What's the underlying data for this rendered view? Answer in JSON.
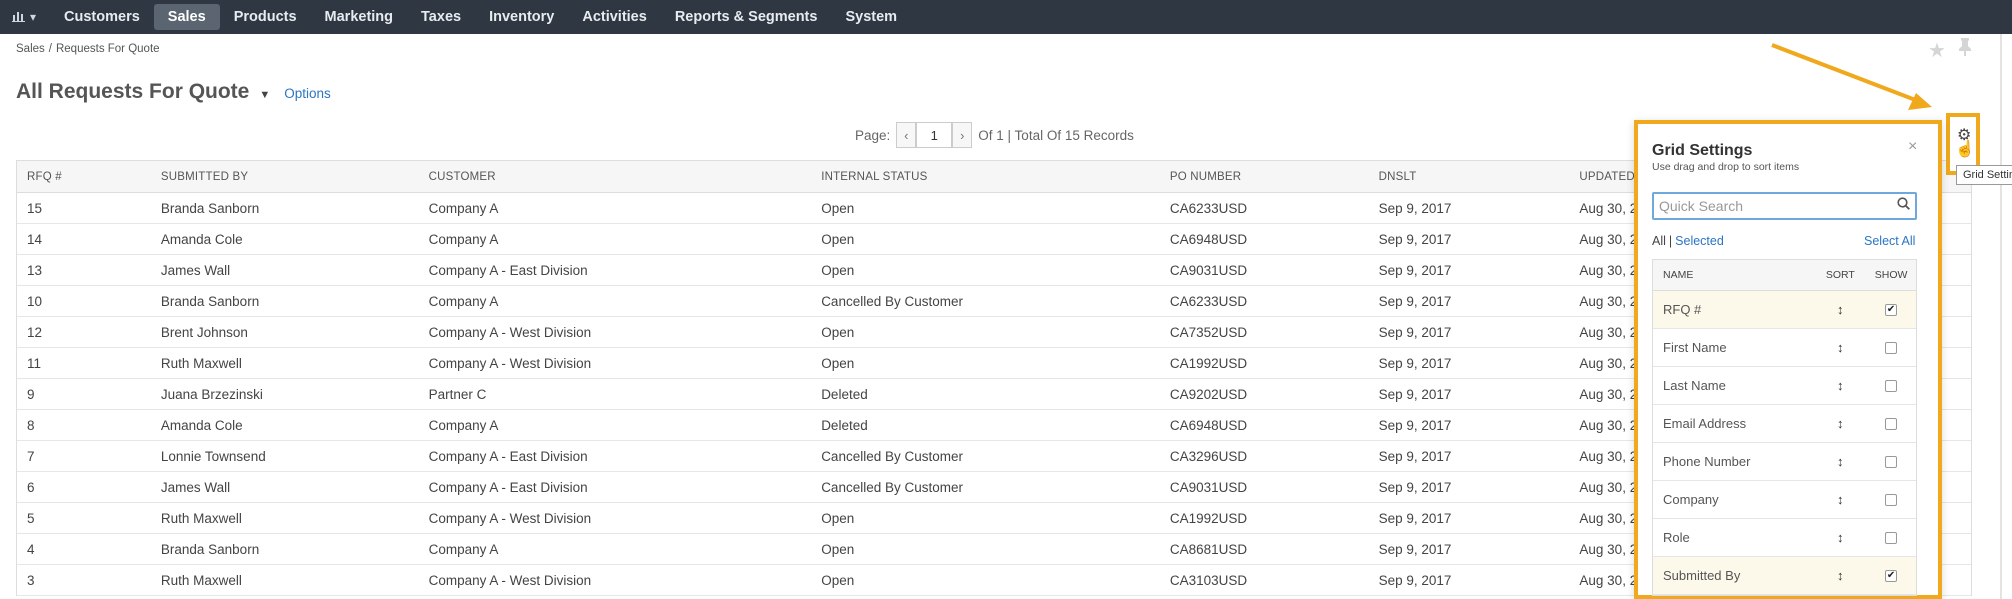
{
  "nav": {
    "items": [
      {
        "label": "Customers",
        "active": false
      },
      {
        "label": "Sales",
        "active": true
      },
      {
        "label": "Products",
        "active": false
      },
      {
        "label": "Marketing",
        "active": false
      },
      {
        "label": "Taxes",
        "active": false
      },
      {
        "label": "Inventory",
        "active": false
      },
      {
        "label": "Activities",
        "active": false
      },
      {
        "label": "Reports & Segments",
        "active": false
      },
      {
        "label": "System",
        "active": false
      }
    ]
  },
  "breadcrumb": {
    "root": "Sales",
    "sep": "/",
    "current": "Requests For Quote"
  },
  "title": {
    "text": "All Requests For Quote",
    "options": "Options"
  },
  "pager": {
    "label": "Page:",
    "current": "1",
    "summary": "Of 1 | Total Of 15 Records"
  },
  "grid": {
    "columns": [
      "RFQ #",
      "SUBMITTED BY",
      "CUSTOMER",
      "INTERNAL STATUS",
      "PO NUMBER",
      "DNSLT",
      "UPDATED"
    ],
    "rows": [
      [
        "15",
        "Branda Sanborn",
        "Company A",
        "Open",
        "CA6233USD",
        "Sep 9, 2017",
        "Aug 30, 2"
      ],
      [
        "14",
        "Amanda Cole",
        "Company A",
        "Open",
        "CA6948USD",
        "Sep 9, 2017",
        "Aug 30, 2"
      ],
      [
        "13",
        "James Wall",
        "Company A - East Division",
        "Open",
        "CA9031USD",
        "Sep 9, 2017",
        "Aug 30, 2"
      ],
      [
        "10",
        "Branda Sanborn",
        "Company A",
        "Cancelled By Customer",
        "CA6233USD",
        "Sep 9, 2017",
        "Aug 30, 2"
      ],
      [
        "12",
        "Brent Johnson",
        "Company A - West Division",
        "Open",
        "CA7352USD",
        "Sep 9, 2017",
        "Aug 30, 2"
      ],
      [
        "11",
        "Ruth Maxwell",
        "Company A - West Division",
        "Open",
        "CA1992USD",
        "Sep 9, 2017",
        "Aug 30, 2"
      ],
      [
        "9",
        "Juana Brzezinski",
        "Partner C",
        "Deleted",
        "CA9202USD",
        "Sep 9, 2017",
        "Aug 30, 2"
      ],
      [
        "8",
        "Amanda Cole",
        "Company A",
        "Deleted",
        "CA6948USD",
        "Sep 9, 2017",
        "Aug 30, 2"
      ],
      [
        "7",
        "Lonnie Townsend",
        "Company A - East Division",
        "Cancelled By Customer",
        "CA3296USD",
        "Sep 9, 2017",
        "Aug 30, 2"
      ],
      [
        "6",
        "James Wall",
        "Company A - East Division",
        "Cancelled By Customer",
        "CA9031USD",
        "Sep 9, 2017",
        "Aug 30, 2"
      ],
      [
        "5",
        "Ruth Maxwell",
        "Company A - West Division",
        "Open",
        "CA1992USD",
        "Sep 9, 2017",
        "Aug 30, 2"
      ],
      [
        "4",
        "Branda Sanborn",
        "Company A",
        "Open",
        "CA8681USD",
        "Sep 9, 2017",
        "Aug 30, 2"
      ],
      [
        "3",
        "Ruth Maxwell",
        "Company A - West Division",
        "Open",
        "CA3103USD",
        "Sep 9, 2017",
        "Aug 30, 2"
      ]
    ]
  },
  "tooltip": "Grid Settings",
  "grid_settings": {
    "title": "Grid Settings",
    "subtitle": "Use drag and drop to sort items",
    "close": "×",
    "search_placeholder": "Quick Search",
    "filter_all": "All",
    "filter_sep": "|",
    "filter_selected": "Selected",
    "select_all": "Select All",
    "headers": {
      "name": "NAME",
      "sort": "SORT",
      "show": "SHOW"
    },
    "items": [
      {
        "name": "RFQ #",
        "checked": true
      },
      {
        "name": "First Name",
        "checked": false
      },
      {
        "name": "Last Name",
        "checked": false
      },
      {
        "name": "Email Address",
        "checked": false
      },
      {
        "name": "Phone Number",
        "checked": false
      },
      {
        "name": "Company",
        "checked": false
      },
      {
        "name": "Role",
        "checked": false
      },
      {
        "name": "Submitted By",
        "checked": true
      }
    ]
  },
  "colors": {
    "nav_bg": "#2f3742",
    "highlight": "#f0a81c",
    "link": "#2a75c4"
  }
}
